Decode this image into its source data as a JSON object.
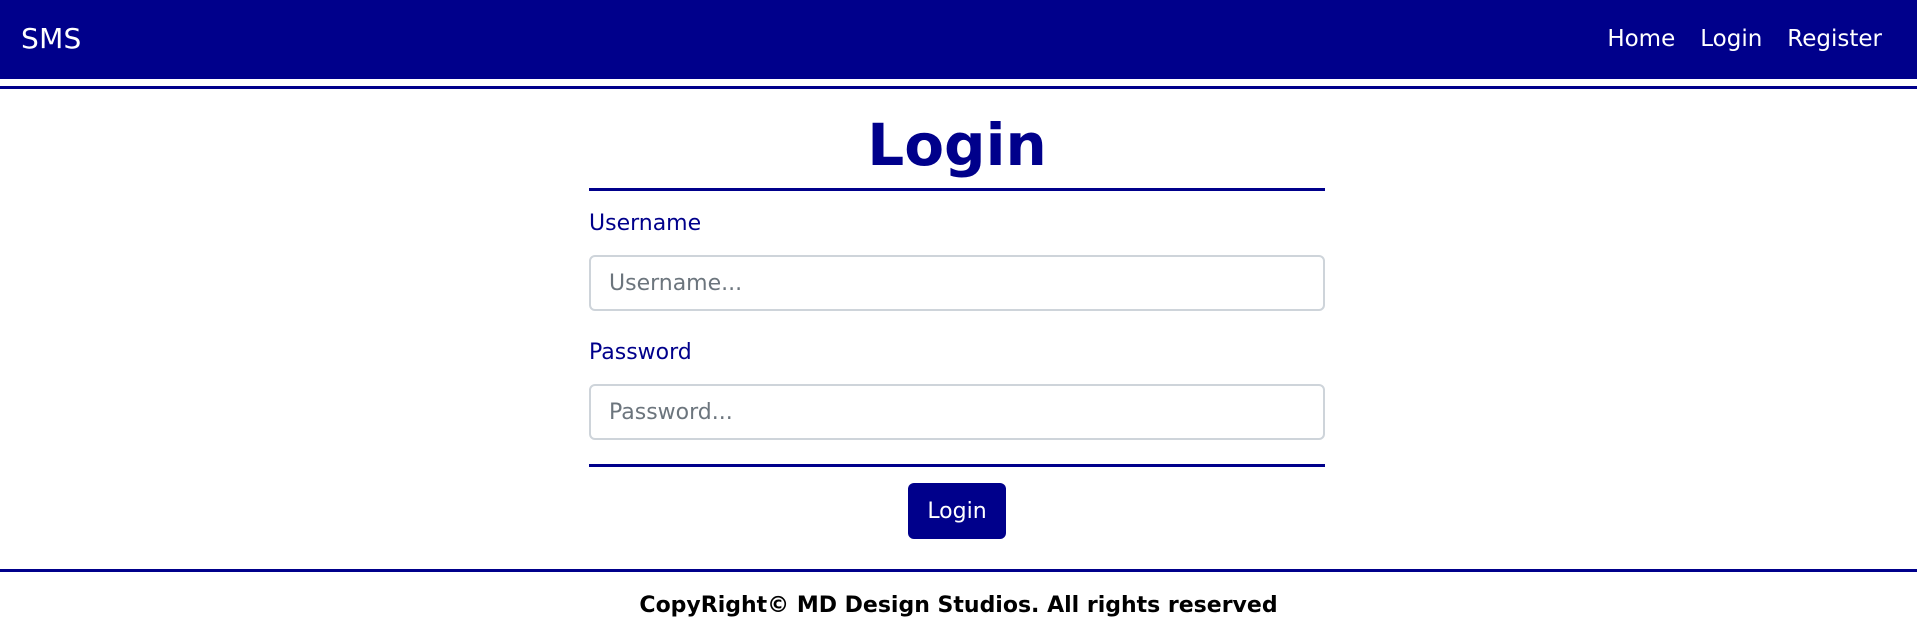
{
  "navbar": {
    "brand": "SMS",
    "links": [
      {
        "label": "Home"
      },
      {
        "label": "Login"
      },
      {
        "label": "Register"
      }
    ]
  },
  "form": {
    "title": "Login",
    "username": {
      "label": "Username",
      "placeholder": "Username...",
      "value": ""
    },
    "password": {
      "label": "Password",
      "placeholder": "Password...",
      "value": ""
    },
    "submit_label": "Login"
  },
  "footer": {
    "text": "CopyRight© MD Design Studios. All rights reserved"
  },
  "colors": {
    "primary": "#00008b",
    "background": "#ffffff",
    "input_border": "#ced4da",
    "placeholder": "#6c757d",
    "footer_text": "#000000"
  }
}
